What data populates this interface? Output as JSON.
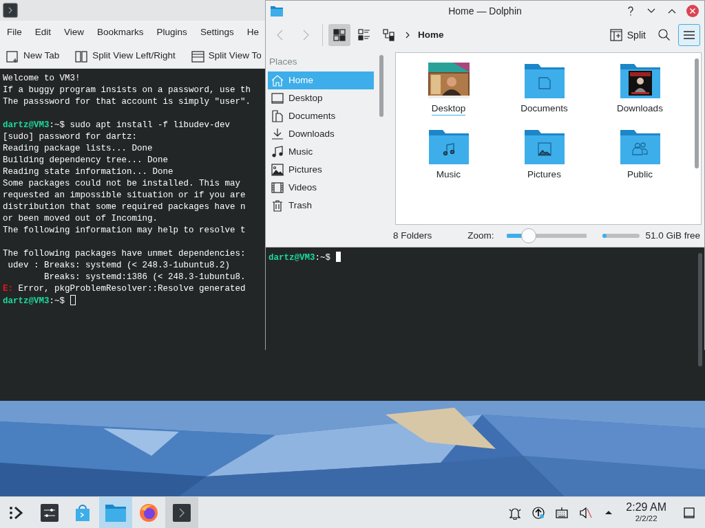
{
  "konsole": {
    "menu": [
      "File",
      "Edit",
      "View",
      "Bookmarks",
      "Plugins",
      "Settings",
      "He"
    ],
    "toolbar": [
      {
        "kind": "new-tab",
        "label": "New Tab"
      },
      {
        "kind": "split-lr",
        "label": "Split View Left/Right"
      },
      {
        "kind": "split-tb",
        "label": "Split View To"
      }
    ],
    "lines": [
      {
        "kind": "text",
        "text": "Welcome to VM3!"
      },
      {
        "kind": "text",
        "text": "If a buggy program insists on a password, use th"
      },
      {
        "kind": "text",
        "text": "The passsword for that account is simply \"user\"."
      },
      {
        "kind": "blank"
      },
      {
        "kind": "prompt",
        "prompt": "dartz@VM3",
        "path": ":~$",
        "command": "sudo apt install -f libudev-dev"
      },
      {
        "kind": "text",
        "text": "[sudo] password for dartz:"
      },
      {
        "kind": "text",
        "text": "Reading package lists... Done"
      },
      {
        "kind": "text",
        "text": "Building dependency tree... Done"
      },
      {
        "kind": "text",
        "text": "Reading state information... Done"
      },
      {
        "kind": "text",
        "text": "Some packages could not be installed. This may"
      },
      {
        "kind": "text",
        "text": "requested an impossible situation or if you are"
      },
      {
        "kind": "text",
        "text": "distribution that some required packages have n"
      },
      {
        "kind": "text",
        "text": "or been moved out of Incoming."
      },
      {
        "kind": "text",
        "text": "The following information may help to resolve t"
      },
      {
        "kind": "blank"
      },
      {
        "kind": "text",
        "text": "The following packages have unmet dependencies:"
      },
      {
        "kind": "text",
        "text": " udev : Breaks: systemd (< 248.3-1ubuntu8.2)"
      },
      {
        "kind": "text",
        "text": "        Breaks: systemd:i386 (< 248.3-1ubuntu8."
      },
      {
        "kind": "error",
        "tag": "E:",
        "text": "Error, pkgProblemResolver::Resolve generated"
      },
      {
        "kind": "prompt",
        "prompt": "dartz@VM3",
        "path": ":~$",
        "cursor_focused": false
      }
    ]
  },
  "dolphin": {
    "title": "Home — Dolphin",
    "nav": [
      {
        "kind": "back",
        "disabled": true
      },
      {
        "kind": "forward",
        "disabled": true
      }
    ],
    "views": [
      {
        "kind": "icons",
        "selected": true
      },
      {
        "kind": "details",
        "selected": false
      },
      {
        "kind": "tree",
        "selected": false
      }
    ],
    "breadcrumb": "Home",
    "split_label": "Split",
    "menu_highlighted": true,
    "places_title": "Places",
    "places": [
      {
        "kind": "home",
        "label": "Home",
        "selected": true
      },
      {
        "kind": "desktop",
        "label": "Desktop",
        "selected": false
      },
      {
        "kind": "documents",
        "label": "Documents",
        "selected": false
      },
      {
        "kind": "downloads",
        "label": "Downloads",
        "selected": false
      },
      {
        "kind": "music",
        "label": "Music",
        "selected": false
      },
      {
        "kind": "pictures",
        "label": "Pictures",
        "selected": false
      },
      {
        "kind": "videos",
        "label": "Videos",
        "selected": false
      },
      {
        "kind": "trash",
        "label": "Trash",
        "selected": false
      }
    ],
    "items": [
      {
        "kind": "picture",
        "label": "Desktop",
        "focused": true
      },
      {
        "kind": "document",
        "label": "Documents",
        "focused": false
      },
      {
        "kind": "poster",
        "label": "Downloads",
        "focused": false
      },
      {
        "kind": "music",
        "label": "Music",
        "focused": false
      },
      {
        "label": "Pictures",
        "focused": false
      },
      {
        "kind": "people",
        "label": "Public",
        "focused": false
      }
    ],
    "status": "8 Folders",
    "zoom_label": "Zoom:",
    "zoom": {
      "level": 0.27
    },
    "space": {
      "level": 0.1
    },
    "free": "51.0 GiB free",
    "terminal": {
      "prompt": "dartz@VM3",
      "path": ":~$",
      "cursor_focused": true
    }
  },
  "taskbar": {
    "apps": [
      {
        "kind": "launcher",
        "active": false,
        "open": false
      },
      {
        "kind": "settings",
        "active": false,
        "open": false
      },
      {
        "kind": "store",
        "active": false,
        "open": false
      },
      {
        "kind": "files",
        "active": true
      },
      {
        "kind": "browser",
        "active": false,
        "open": false
      },
      {
        "kind": "terminal",
        "active": false,
        "open": true
      }
    ],
    "tray": [
      {
        "kind": "bell"
      },
      {
        "kind": "update"
      },
      {
        "kind": "keyboard"
      },
      {
        "kind": "muted"
      },
      {
        "kind": "expand"
      }
    ],
    "time": "2:29 AM",
    "date": "2/2/22"
  }
}
